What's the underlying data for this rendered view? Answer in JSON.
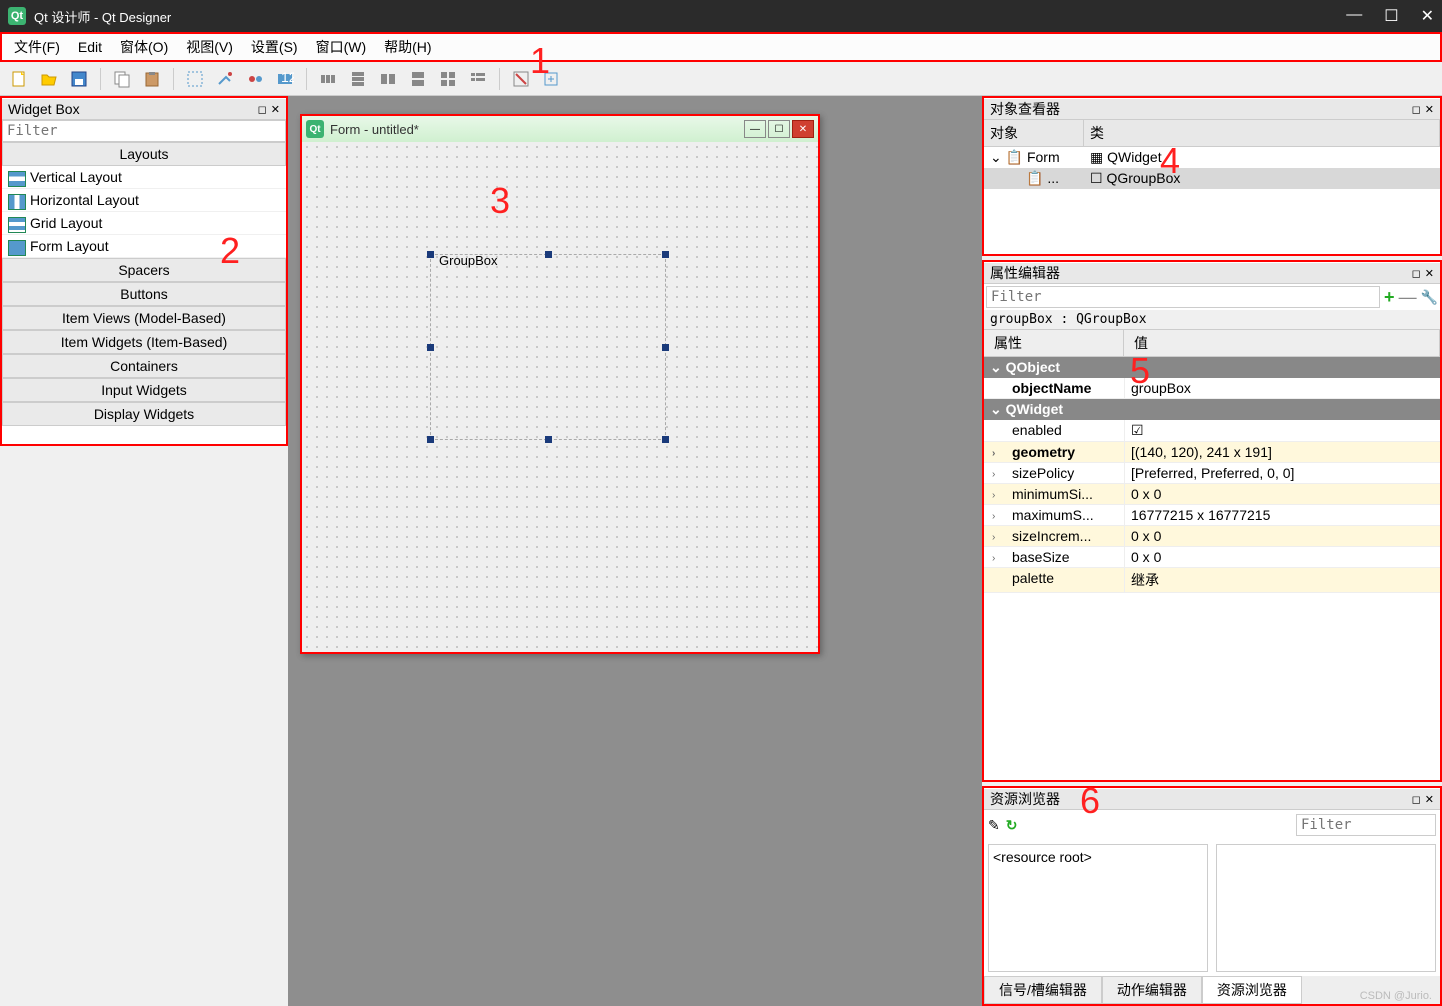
{
  "window": {
    "title": "Qt 设计师 - Qt Designer"
  },
  "menu": [
    "文件(F)",
    "Edit",
    "窗体(O)",
    "视图(V)",
    "设置(S)",
    "窗口(W)",
    "帮助(H)"
  ],
  "widgetbox": {
    "title": "Widget Box",
    "filter": "Filter",
    "cat_layouts": "Layouts",
    "layouts": [
      "Vertical Layout",
      "Horizontal Layout",
      "Grid Layout",
      "Form Layout"
    ],
    "cats": [
      "Spacers",
      "Buttons",
      "Item Views (Model-Based)",
      "Item Widgets (Item-Based)",
      "Containers",
      "Input Widgets",
      "Display Widgets"
    ]
  },
  "form": {
    "title": "Form - untitled*",
    "groupbox": "GroupBox"
  },
  "objinsp": {
    "title": "对象查看器",
    "cols": [
      "对象",
      "类"
    ],
    "root_obj": "Form",
    "root_cls": "QWidget",
    "child_obj": "...",
    "child_cls": "QGroupBox"
  },
  "propedit": {
    "title": "属性编辑器",
    "filter": "Filter",
    "objline": "groupBox : QGroupBox",
    "cols": [
      "属性",
      "值"
    ],
    "grp_qobject": "QObject",
    "objectName": {
      "n": "objectName",
      "v": "groupBox"
    },
    "grp_qwidget": "QWidget",
    "rows": [
      {
        "n": "enabled",
        "v": "☑",
        "y": false,
        "arrow": ""
      },
      {
        "n": "geometry",
        "v": "[(140, 120), 241 x 191]",
        "y": true,
        "arrow": "›",
        "bold": true
      },
      {
        "n": "sizePolicy",
        "v": "[Preferred, Preferred, 0, 0]",
        "y": false,
        "arrow": "›"
      },
      {
        "n": "minimumSi...",
        "v": "0 x 0",
        "y": true,
        "arrow": "›"
      },
      {
        "n": "maximumS...",
        "v": "16777215 x 16777215",
        "y": false,
        "arrow": "›"
      },
      {
        "n": "sizeIncrem...",
        "v": "0 x 0",
        "y": true,
        "arrow": "›"
      },
      {
        "n": "baseSize",
        "v": "0 x 0",
        "y": false,
        "arrow": "›"
      },
      {
        "n": "palette",
        "v": "继承",
        "y": true,
        "arrow": ""
      }
    ]
  },
  "resbrowser": {
    "title": "资源浏览器",
    "filter": "Filter",
    "root": "<resource root>",
    "tabs": [
      "信号/槽编辑器",
      "动作编辑器",
      "资源浏览器"
    ]
  },
  "anno": {
    "1": "1",
    "2": "2",
    "3": "3",
    "4": "4",
    "5": "5",
    "6": "6"
  },
  "watermark": "CSDN @Jurio."
}
